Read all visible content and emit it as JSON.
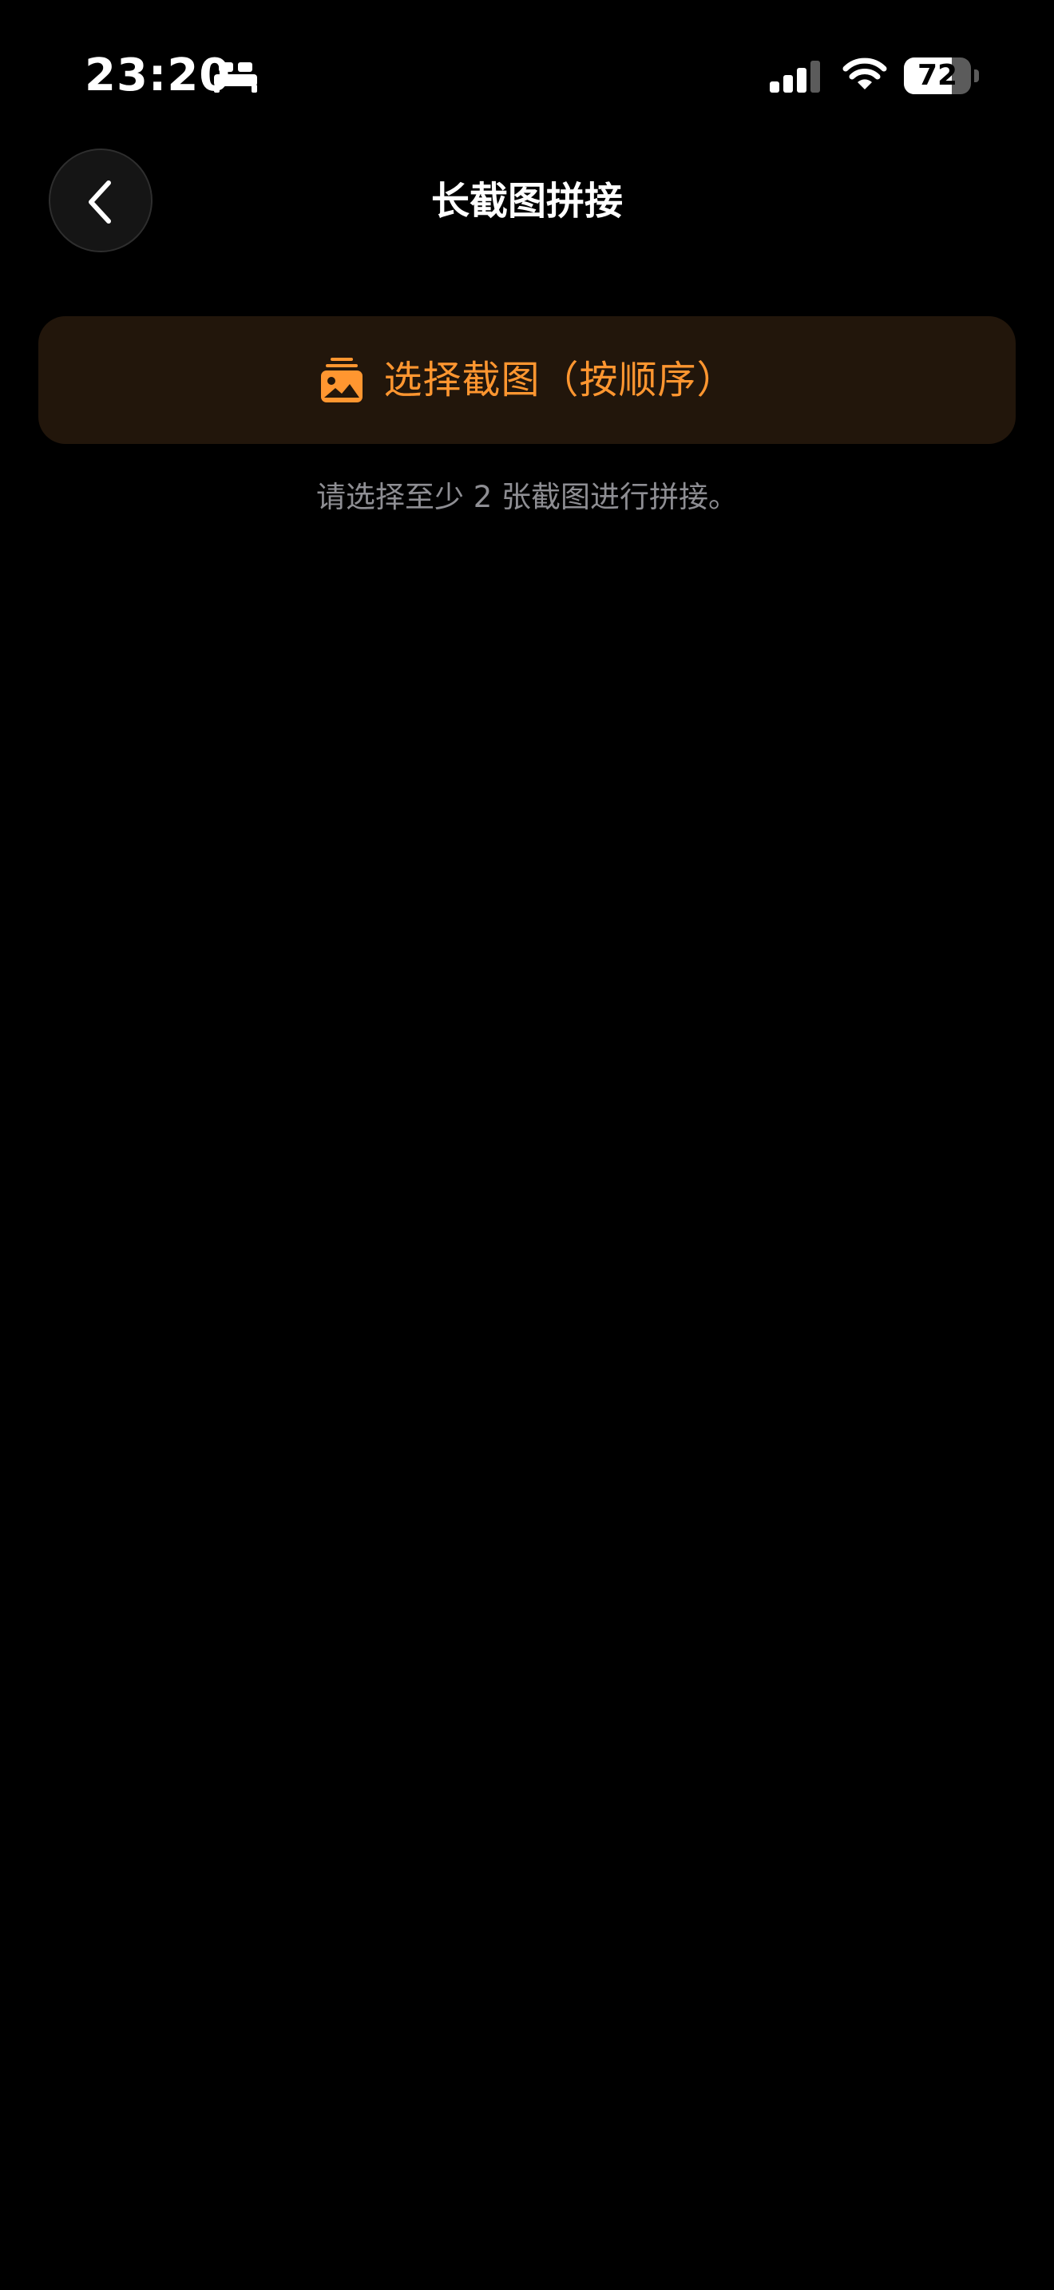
{
  "status_bar": {
    "time": "23:20",
    "battery_level": "72",
    "battery_fraction": 0.72,
    "icons": [
      "sleep-bed-icon",
      "cellular-signal-icon",
      "wifi-icon",
      "battery-icon"
    ]
  },
  "nav": {
    "back_icon": "chevron-left-icon",
    "title": "长截图拼接"
  },
  "main": {
    "select_button": {
      "icon": "photo-stack-icon",
      "label": "选择截图（按顺序）"
    },
    "hint": "请选择至少 2 张截图进行拼接。"
  },
  "colors": {
    "background": "#000000",
    "accent": "#ff9630",
    "button_background": "#22160b",
    "secondary_text": "#8e8e93",
    "primary_text": "#ffffff"
  }
}
